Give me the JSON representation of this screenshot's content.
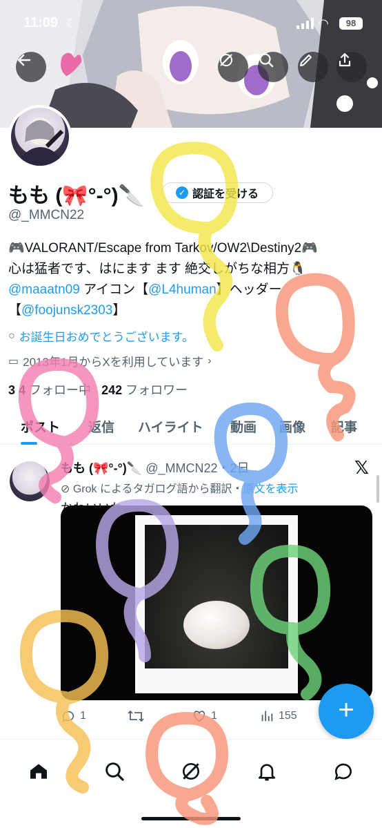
{
  "status_bar": {
    "time": "11:09",
    "battery": "98"
  },
  "header": {
    "buttons": [
      "back-icon",
      "grok-icon",
      "search-icon",
      "edit-icon",
      "share-icon"
    ]
  },
  "profile": {
    "name": "もも (🎀°-°)🔪",
    "handle": "@_MMCN22",
    "verify_button_label": "認証を受ける",
    "bio_line1": "🎮VALORANT/Escape from Tarkov/OW2\\Destiny2🎮",
    "bio_line2": "心は猛者です、はにます ます 絶交しがちな相方🐧",
    "bio_link1": "@maaatn09",
    "bio_mid1": " アイコン【",
    "bio_link2": "@L4human",
    "bio_mid2": "】ヘッダー",
    "bio_line4_prefix": "【",
    "bio_link3": "@foojunsk2303",
    "bio_line4_suffix": "】",
    "birthday_text": "お誕生日おめでとうございます。",
    "joined_text": "2013年1月からXを利用しています",
    "following_count": "3 4",
    "following_label": "フォロー中",
    "followers_count": "242",
    "followers_label": "フォロワー"
  },
  "tabs": [
    "ポスト",
    "返信",
    "ハイライト",
    "動画",
    "画像",
    "記事"
  ],
  "post": {
    "author_name": "もも (🎀°-°)🔪",
    "author_handle": "@_MMCN22・2日",
    "grok_prefix": "Grok によるタガログ語から",
    "grok_mid": "翻訳",
    "grok_link": "原文を表示",
    "text": "かわいいね",
    "reply_count": "1",
    "like_count": "1",
    "views_count": "155"
  },
  "colors": {
    "accent": "#1d9bf0",
    "text": "#0f1419",
    "muted": "#536471"
  }
}
